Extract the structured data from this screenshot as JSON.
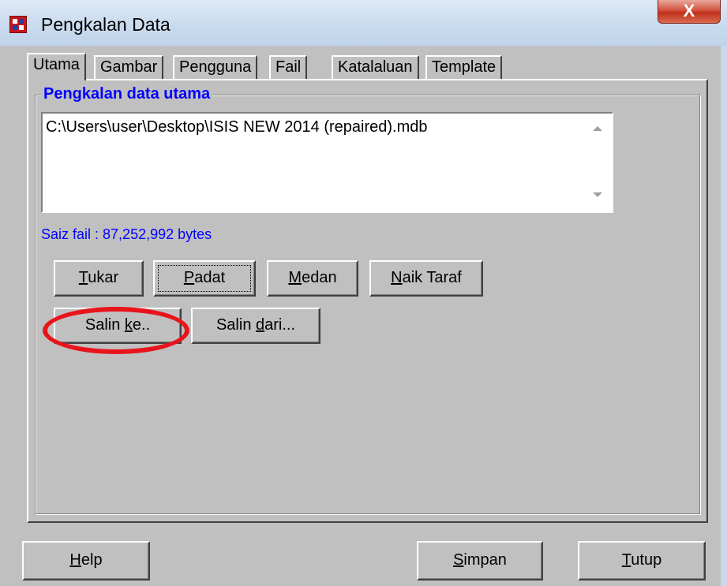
{
  "window": {
    "title": "Pengkalan Data",
    "close_label": "X"
  },
  "tabs": [
    {
      "label": "Utama",
      "active": true
    },
    {
      "label": "Gambar"
    },
    {
      "label": "Pengguna"
    },
    {
      "label": "Fail"
    },
    {
      "label": "Katalaluan"
    },
    {
      "label": "Template"
    }
  ],
  "group": {
    "title": "Pengkalan data utama",
    "path": "C:\\Users\\user\\Desktop\\ISIS NEW 2014 (repaired).mdb",
    "size_text": "Saiz fail : 87,252,992 bytes"
  },
  "buttons": {
    "tukar": {
      "u": "T",
      "rest": "ukar"
    },
    "padat": {
      "u": "P",
      "rest": "adat"
    },
    "medan": {
      "u": "M",
      "rest": "edan"
    },
    "naik_taraf": {
      "u": "N",
      "rest": "aik Taraf"
    },
    "salin_ke": {
      "pre": "Salin ",
      "u": "k",
      "rest": "e.."
    },
    "salin_dari": {
      "pre": "Salin ",
      "u": "d",
      "rest": "ari..."
    }
  },
  "footer": {
    "help": {
      "u": "H",
      "rest": "elp"
    },
    "simpan": {
      "u": "S",
      "rest": "impan"
    },
    "tutup": {
      "u": "T",
      "rest": "utup"
    }
  },
  "colors": {
    "accent": "#0000ff",
    "highlight": "#e8141b",
    "face": "#c0c0c0"
  }
}
